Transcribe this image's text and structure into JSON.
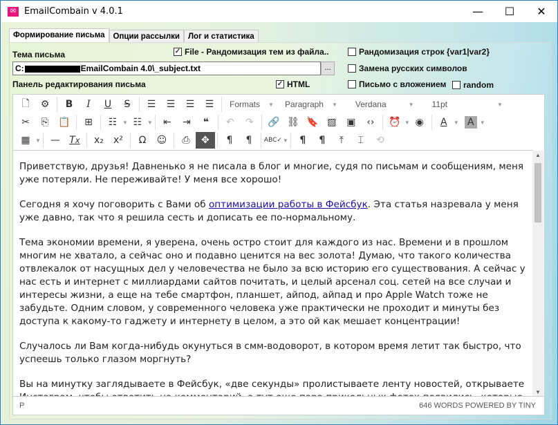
{
  "window": {
    "title": "EmailCombain v 4.0.1",
    "minimize": "—",
    "maximize": "☐",
    "close": "✕"
  },
  "tabs": [
    {
      "label": "Формирование письма"
    },
    {
      "label": "Опции рассылки"
    },
    {
      "label": "Лог и статистика"
    }
  ],
  "form": {
    "subject_label": "Тема письма",
    "file_random": {
      "label": "File - Рандомизация тем из файла..",
      "checked": true
    },
    "path_prefix": "C:",
    "path_suffix": "EmailCombain 4.0\\_subject.txt",
    "browse_label": "...",
    "editor_label": "Панель редактирования письма",
    "html": {
      "label": "HTML",
      "checked": true
    },
    "random_lines": {
      "label": "Рандомизация строк {var1|var2}",
      "checked": false
    },
    "replace_ru": {
      "label": "Замена русских символов",
      "checked": false
    },
    "attachment": {
      "label": "Письмо с вложением",
      "checked": false
    },
    "random": {
      "label": "random",
      "checked": false
    }
  },
  "toolbar": {
    "formats": "Formats",
    "block": "Paragraph",
    "font": "Verdana",
    "size": "11pt"
  },
  "content": {
    "p1": "Приветствую, друзья! Давненько я не писала в блог и многие, судя по письмам и сообщениям, меня уже потеряли. Не переживайте! У меня все хорошо!",
    "p2_before": "Сегодня я хочу поговорить с Вами об ",
    "p2_link": "оптимизации работы в Фейсбук",
    "p2_after": ". Эта статья назревала у меня уже давно, так что я решила сесть и дописать ее по-нормальному.",
    "p3": "Тема экономии времени, я уверена, очень остро стоит для каждого из нас. Времени и в прошлом многим не хватало, а сейчас оно и подавно ценится на вес золота! Думаю, что такого количества отвлекалок от насущных дел у человечества не было за всю историю его существования. А сейчас у нас есть и интернет с миллиардами сайтов почитать, и целый арсенал соц. сетей на все случаи и интересы жизни, а еще на тебе смартфон, планшет, айпод, айпад и про Apple Watch тоже не забудьте. Одним словом, у современного человека уже практически не проходит и минуты без доступа к какому-то гаджету и интернету в целом, а это ой как мешает концентрации!",
    "p4": "Случалось ли Вам когда-нибудь окунуться в смм-водоворот, в котором время летит так быстро, что успеешь только глазом моргнуть?",
    "p5": "Вы на минутку заглядываете в Фейсбук, «две секунды» пролистываете ленту новостей, открываете Инстаграм, чтобы ответить на комментарий, а тут еще пара прикольных фоток появились, которые хочется быстренько проглядеть, затем проверяете «по-быстрому» активность в ВК, и, выныривая"
  },
  "status": {
    "path": "P",
    "words": "646 WORDS POWERED BY TINY"
  }
}
